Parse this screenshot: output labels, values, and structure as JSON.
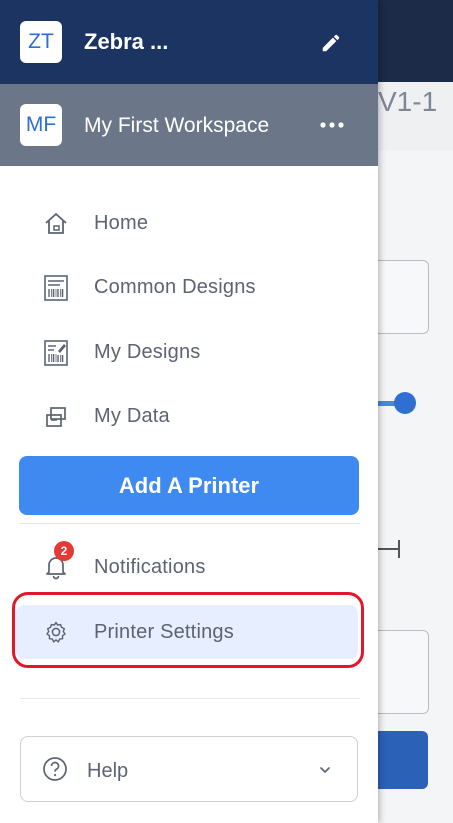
{
  "background": {
    "title_fragment": "V1-1"
  },
  "org": {
    "initials": "ZT",
    "name": "Zebra ..."
  },
  "workspace": {
    "initials": "MF",
    "name": "My First Workspace"
  },
  "nav": {
    "home": "Home",
    "common_designs": "Common Designs",
    "my_designs": "My Designs",
    "my_data": "My Data",
    "add_printer": "Add A Printer",
    "notifications": "Notifications",
    "notifications_badge": "2",
    "printer_settings": "Printer Settings",
    "help": "Help"
  },
  "icons": {
    "edit": "pencil-icon",
    "more": "more-horizontal-icon",
    "home": "home-icon",
    "common_designs": "barcode-label-icon",
    "my_designs": "barcode-label-edit-icon",
    "my_data": "data-link-icon",
    "notifications": "bell-icon",
    "printer_settings": "gear-icon",
    "help": "question-circle-icon",
    "help_chevron": "chevron-down-icon"
  },
  "colors": {
    "org_bar": "#1b3462",
    "workspace_bar": "#6b7788",
    "primary_button": "#3f8af0",
    "selected_bg": "#e6eeff",
    "highlight_ring": "#e3172a",
    "badge": "#e53935"
  }
}
